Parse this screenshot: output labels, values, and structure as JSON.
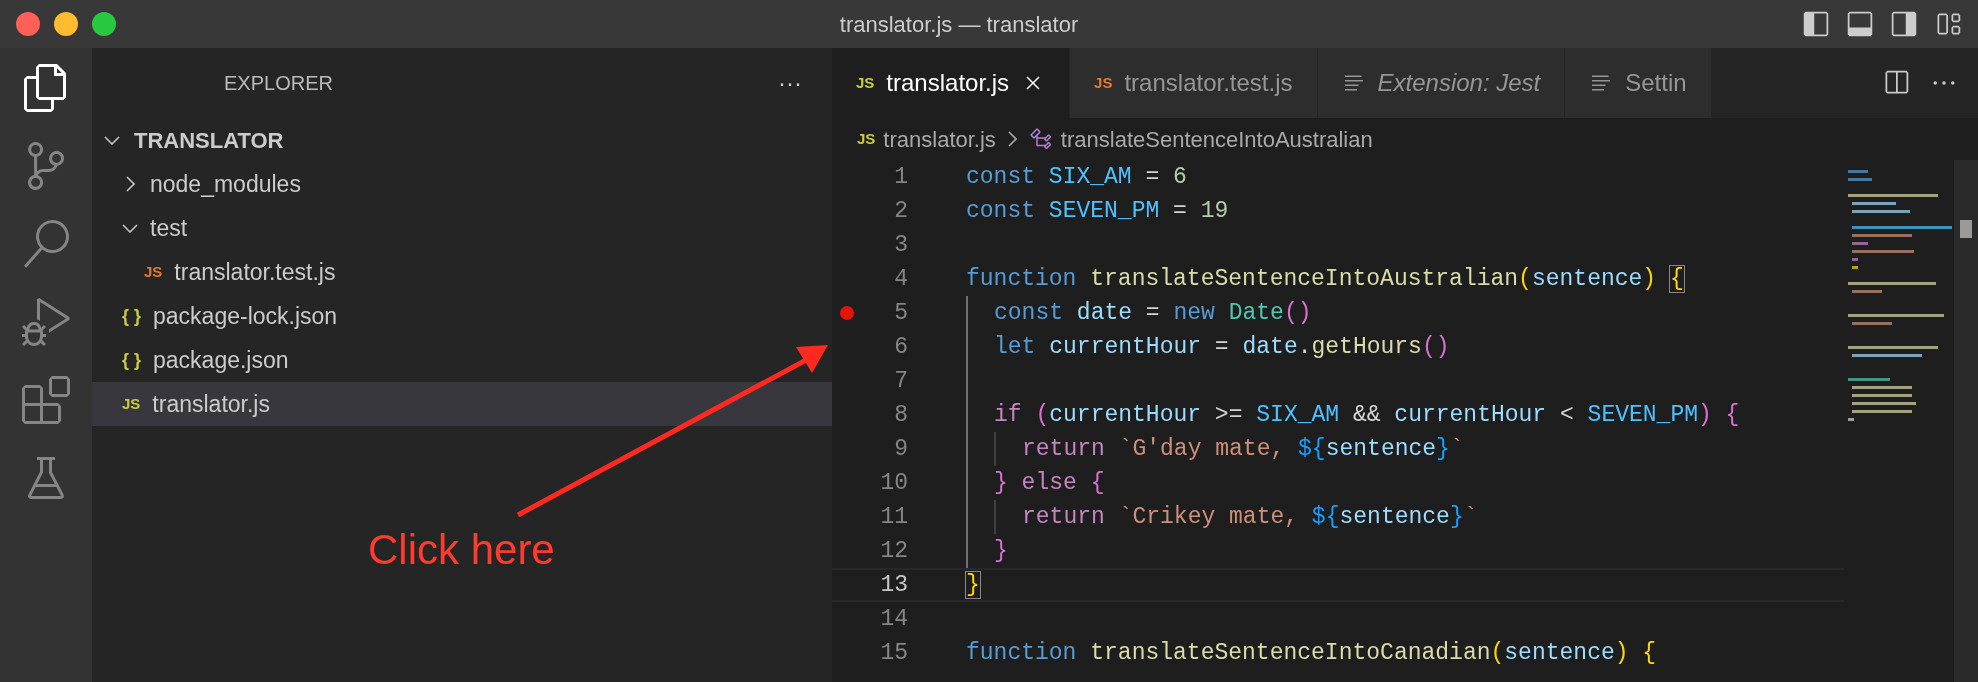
{
  "window": {
    "title": "translator.js — translator"
  },
  "activity_bar": [
    {
      "kind": "files",
      "selected": true
    },
    {
      "kind": "source-control",
      "selected": false
    },
    {
      "kind": "search",
      "selected": false
    },
    {
      "kind": "run-debug",
      "selected": false
    },
    {
      "kind": "extensions",
      "selected": false
    },
    {
      "kind": "testing",
      "selected": false
    }
  ],
  "sidebar": {
    "title": "EXPLORER",
    "more": "···",
    "root": {
      "label": "TRANSLATOR",
      "expanded": true,
      "children": [
        {
          "label": "node_modules",
          "kind": "folder",
          "expanded": false,
          "selected": false
        },
        {
          "label": "test",
          "kind": "folder",
          "expanded": true,
          "selected": false,
          "children": [
            {
              "label": "translator.test.js",
              "kind": "js",
              "badge": "JS",
              "color": "#e37933",
              "selected": false
            }
          ]
        },
        {
          "label": "package-lock.json",
          "kind": "json",
          "badge": "{ }",
          "color": "#cbcb41",
          "selected": false
        },
        {
          "label": "package.json",
          "kind": "json",
          "badge": "{ }",
          "color": "#cbcb41",
          "selected": false
        },
        {
          "label": "translator.js",
          "kind": "js",
          "badge": "JS",
          "color": "#cbcb41",
          "selected": true
        }
      ]
    }
  },
  "tabs": [
    {
      "label": "translator.js",
      "kind": "file",
      "badge": "JS",
      "color": "#cbcb41",
      "italic": false,
      "selected": true
    },
    {
      "label": "translator.test.js",
      "kind": "file",
      "badge": "JS",
      "color": "#e37933",
      "italic": false,
      "selected": false
    },
    {
      "label": "Extension: Jest",
      "kind": "document",
      "italic": true,
      "selected": false
    },
    {
      "label": "Settin",
      "kind": "document",
      "italic": false,
      "selected": false
    }
  ],
  "breadcrumb": {
    "badge": "JS",
    "file": "translator.js",
    "symbol": "translateSentenceIntoAustralian"
  },
  "editor": {
    "lines": [
      {
        "number": "1",
        "current": false,
        "breakpoint": false,
        "tokens": [
          {
            "kind": "keyword",
            "text": "const "
          },
          {
            "kind": "constant",
            "text": "SIX_AM"
          },
          {
            "kind": "plain",
            "text": " = "
          },
          {
            "kind": "number",
            "text": "6"
          }
        ]
      },
      {
        "number": "2",
        "current": false,
        "breakpoint": false,
        "tokens": [
          {
            "kind": "keyword",
            "text": "const "
          },
          {
            "kind": "constant",
            "text": "SEVEN_PM"
          },
          {
            "kind": "plain",
            "text": " = "
          },
          {
            "kind": "number",
            "text": "19"
          }
        ]
      },
      {
        "number": "3",
        "current": false,
        "breakpoint": false
      },
      {
        "number": "4",
        "current": false,
        "breakpoint": false,
        "tokens": [
          {
            "kind": "keyword",
            "text": "function "
          },
          {
            "kind": "function",
            "text": "translateSentenceIntoAustralian"
          },
          {
            "kind": "bracket1",
            "text": "("
          },
          {
            "kind": "variable",
            "text": "sentence"
          },
          {
            "kind": "bracket1",
            "text": ") "
          },
          {
            "kind": "bracket-match",
            "text": "{"
          }
        ]
      },
      {
        "number": "5",
        "current": false,
        "breakpoint": true,
        "guides": [
          {
            "active": true
          }
        ],
        "tokens": [
          {
            "kind": "keyword",
            "text": "const "
          },
          {
            "kind": "variable",
            "text": "date"
          },
          {
            "kind": "plain",
            "text": " = "
          },
          {
            "kind": "keyword",
            "text": "new "
          },
          {
            "kind": "class",
            "text": "Date"
          },
          {
            "kind": "bracket2",
            "text": "()"
          }
        ]
      },
      {
        "number": "6",
        "current": false,
        "breakpoint": false,
        "guides": [
          {
            "active": true
          }
        ],
        "tokens": [
          {
            "kind": "keyword",
            "text": "let "
          },
          {
            "kind": "variable",
            "text": "currentHour"
          },
          {
            "kind": "plain",
            "text": " = "
          },
          {
            "kind": "variable",
            "text": "date"
          },
          {
            "kind": "plain",
            "text": "."
          },
          {
            "kind": "function",
            "text": "getHours"
          },
          {
            "kind": "bracket2",
            "text": "()"
          }
        ]
      },
      {
        "number": "7",
        "current": false,
        "breakpoint": false,
        "guides": [
          {
            "active": true
          }
        ]
      },
      {
        "number": "8",
        "current": false,
        "breakpoint": false,
        "guides": [
          {
            "active": true
          }
        ],
        "tokens": [
          {
            "kind": "control",
            "text": "if "
          },
          {
            "kind": "bracket2",
            "text": "("
          },
          {
            "kind": "variable",
            "text": "currentHour"
          },
          {
            "kind": "plain",
            "text": " >= "
          },
          {
            "kind": "constant",
            "text": "SIX_AM"
          },
          {
            "kind": "plain",
            "text": " && "
          },
          {
            "kind": "variable",
            "text": "currentHour"
          },
          {
            "kind": "plain",
            "text": " < "
          },
          {
            "kind": "constant",
            "text": "SEVEN_PM"
          },
          {
            "kind": "bracket2",
            "text": ") {"
          }
        ]
      },
      {
        "number": "9",
        "current": false,
        "breakpoint": false,
        "guides": [
          {
            "active": true
          },
          {
            "active": false
          }
        ],
        "tokens": [
          {
            "kind": "control",
            "text": "return "
          },
          {
            "kind": "string",
            "text": "`G'day mate, "
          },
          {
            "kind": "template",
            "text": "${"
          },
          {
            "kind": "variable",
            "text": "sentence"
          },
          {
            "kind": "template",
            "text": "}"
          },
          {
            "kind": "string",
            "text": "`"
          }
        ]
      },
      {
        "number": "10",
        "current": false,
        "breakpoint": false,
        "guides": [
          {
            "active": true
          }
        ],
        "tokens": [
          {
            "kind": "bracket2",
            "text": "}"
          },
          {
            "kind": "control",
            "text": " else "
          },
          {
            "kind": "bracket2",
            "text": "{"
          }
        ]
      },
      {
        "number": "11",
        "current": false,
        "breakpoint": false,
        "guides": [
          {
            "active": true
          },
          {
            "active": false
          }
        ],
        "tokens": [
          {
            "kind": "control",
            "text": "return "
          },
          {
            "kind": "string",
            "text": "`Crikey mate, "
          },
          {
            "kind": "template",
            "text": "${"
          },
          {
            "kind": "variable",
            "text": "sentence"
          },
          {
            "kind": "template",
            "text": "}"
          },
          {
            "kind": "string",
            "text": "`"
          }
        ]
      },
      {
        "number": "12",
        "current": false,
        "breakpoint": false,
        "guides": [
          {
            "active": true
          }
        ],
        "tokens": [
          {
            "kind": "bracket2",
            "text": "}"
          }
        ]
      },
      {
        "number": "13",
        "current": true,
        "breakpoint": false,
        "tokens": [
          {
            "kind": "bracket-match",
            "text": "}"
          }
        ]
      },
      {
        "number": "14",
        "current": false,
        "breakpoint": false
      },
      {
        "number": "15",
        "current": false,
        "breakpoint": false,
        "tokens": [
          {
            "kind": "keyword",
            "text": "function "
          },
          {
            "kind": "function",
            "text": "translateSentenceIntoCanadian"
          },
          {
            "kind": "bracket1",
            "text": "("
          },
          {
            "kind": "variable",
            "text": "sentence"
          },
          {
            "kind": "bracket1",
            "text": ") {"
          }
        ]
      }
    ]
  },
  "annotation": {
    "text": "Click here"
  }
}
